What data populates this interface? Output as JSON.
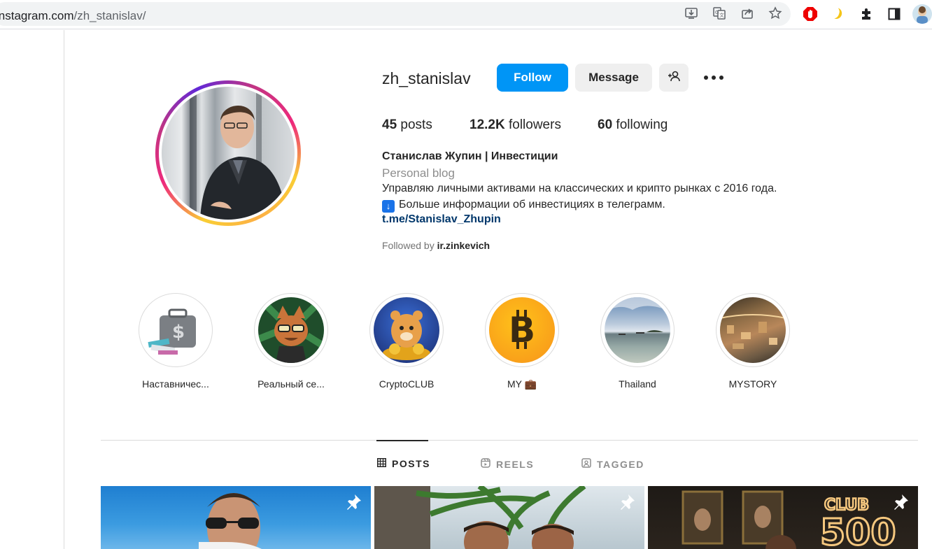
{
  "browser": {
    "url_host": "instagram.com",
    "url_path": "/zh_stanislav/"
  },
  "profile": {
    "username": "zh_stanislav",
    "follow_label": "Follow",
    "message_label": "Message",
    "stats": {
      "posts_count": "45",
      "posts_label": "posts",
      "followers_count": "12.2K",
      "followers_label": "followers",
      "following_count": "60",
      "following_label": "following"
    },
    "full_name": "Станислав Жупин | Инвестиции",
    "category": "Personal blog",
    "bio_line1": "Управляю личными активами на классических и крипто рынках с 2016 года.",
    "bio_line2_icon": "↓",
    "bio_line2": "Больше информации об инвестициях в телеграмм.",
    "link": "t.me/Stanislav_Zhupin",
    "followed_by_prefix": "Followed by",
    "followed_by_user": "ir.zinkevich"
  },
  "highlights": [
    {
      "label": "Наставничес..."
    },
    {
      "label": "Реальный се..."
    },
    {
      "label": "CryptoCLUB"
    },
    {
      "label": "MY 💼"
    },
    {
      "label": "Thailand"
    },
    {
      "label": "MYSTORY"
    }
  ],
  "tabs": [
    {
      "label": "POSTS",
      "active": true
    },
    {
      "label": "REELS",
      "active": false
    },
    {
      "label": "TAGGED",
      "active": false
    }
  ],
  "post_overlay_text": [
    "CLUB",
    "500"
  ],
  "colors": {
    "follow_button": "#0095f6",
    "link": "#00376b",
    "muted": "#8e8e8e"
  }
}
